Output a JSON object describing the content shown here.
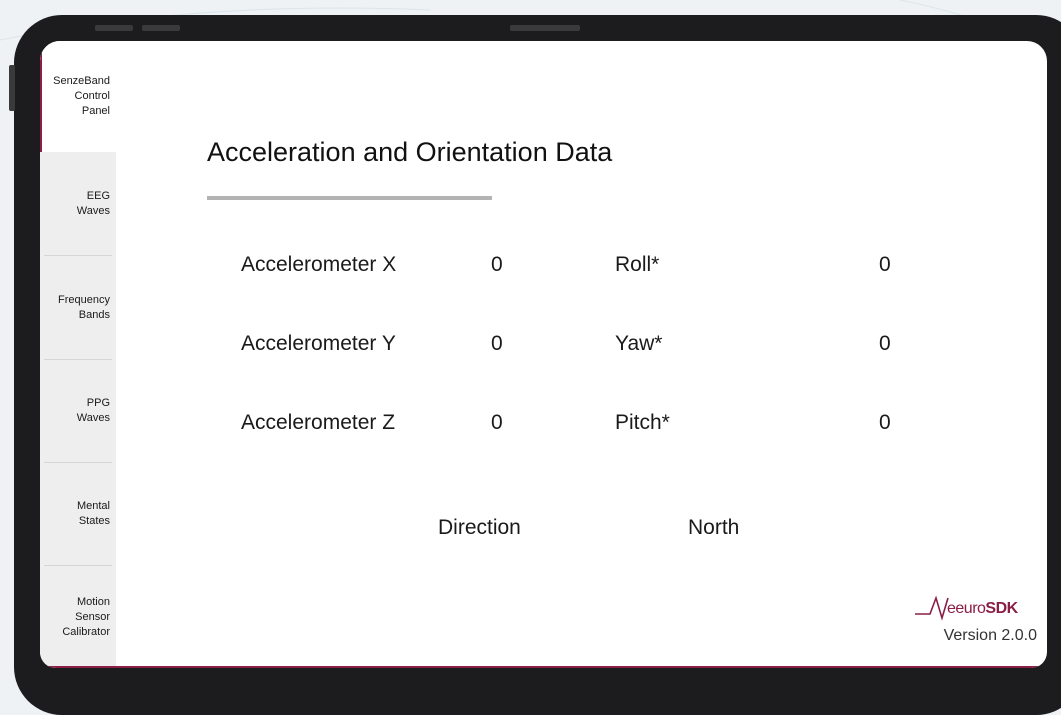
{
  "sidebar": {
    "items": [
      {
        "label": "SenzeBand\nControl\nPanel",
        "active": true
      },
      {
        "label": "EEG\nWaves",
        "active": false
      },
      {
        "label": "Frequency\nBands",
        "active": false
      },
      {
        "label": "PPG\nWaves",
        "active": false
      },
      {
        "label": "Mental\nStates",
        "active": false
      },
      {
        "label": "Motion\nSensor\nCalibrator",
        "active": false
      }
    ]
  },
  "main": {
    "title": "Acceleration and Orientation Data",
    "rows": [
      {
        "label": "Accelerometer X",
        "value": "0",
        "label2": "Roll*",
        "value2": "0"
      },
      {
        "label": "Accelerometer Y",
        "value": "0",
        "label2": "Yaw*",
        "value2": "0"
      },
      {
        "label": "Accelerometer Z",
        "value": "0",
        "label2": "Pitch*",
        "value2": "0"
      }
    ],
    "direction": {
      "label": "Direction",
      "value": "North"
    }
  },
  "footer": {
    "logo_text": "eeuro",
    "logo_bold": "SDK",
    "version": "Version 2.0.0"
  },
  "colors": {
    "accent": "#8a1e46",
    "background": "#ffffff",
    "sidebar": "#eeeeee"
  }
}
